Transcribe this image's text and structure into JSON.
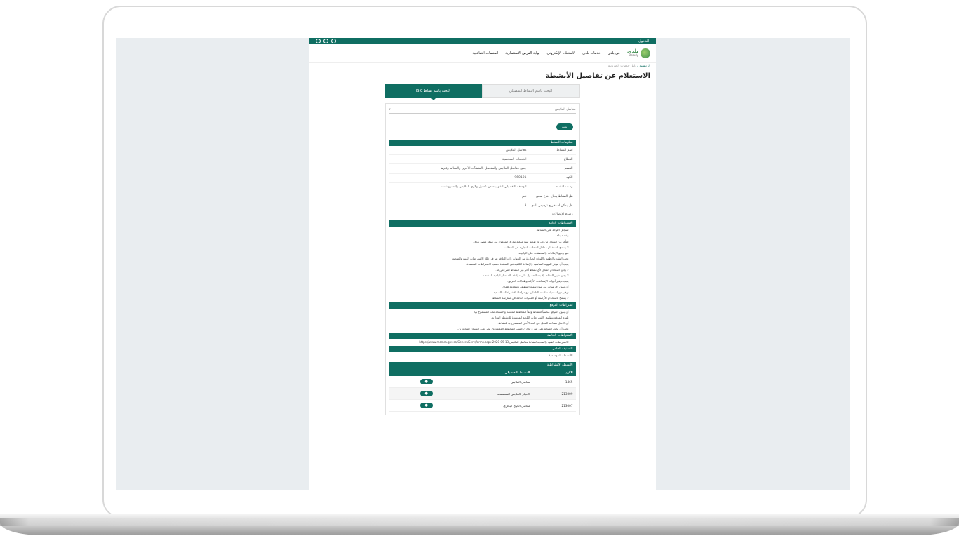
{
  "topbar": {
    "login": "الدخول"
  },
  "nav": {
    "logo_ar": "بلدي",
    "logo_en": "Balady",
    "links": [
      "عن بلدي",
      "خدمات بلدي",
      "الاستعلام الإلكتروني",
      "بوابة الفرص الاستثمارية",
      "المنصات التفاعلية"
    ]
  },
  "breadcrumb": {
    "home": "الرئيسية",
    "current": "دليل خدمات إلكترونية"
  },
  "page_title": "الاستعلام عن تفاصيل الأنشطة",
  "tabs": {
    "active": "البحث باسم نشاط ISIC",
    "inactive": "البحث باسم النشاط التفصيلي"
  },
  "select": {
    "value": "مغاسل الملابس"
  },
  "search_button": "بحث",
  "sections": {
    "info": "معلومات النشاط",
    "conditions": "الاشتراطات العامة",
    "location": "اشتراطات الموقع",
    "special": "الاشتراطات الخاصة",
    "classification": "التصنيف الخاص",
    "related": "الأنشطة الاشتراطية"
  },
  "info_rows": [
    {
      "k": "اسم النشاط",
      "v": "مغاسل الملابس"
    },
    {
      "k": "القطاع",
      "v": "الخدمات الشخصية"
    },
    {
      "k": "القسم",
      "v": "جميع مغاسل الملابس والمغاسل بالمنشآت الأخرى والمعالم وغيرها"
    },
    {
      "k": "الكود",
      "v": "960101"
    },
    {
      "k": "وصف النشاط",
      "v": "الوصف التفصيلي الذي يتضمن غسيل وكوي الملابس والمفروشات"
    },
    {
      "k": "هل النشاط يحتاج دفاع مدني",
      "v": "نعم"
    },
    {
      "k": "هل يمكن استخراج ترخيص بلدي",
      "v": "لا"
    }
  ],
  "category_note": "رسوم الإيصالات",
  "conditions": [
    "تسجيل اللوحة على النشاط.",
    "رخصة بناء.",
    "التأكد من السجل من طريق تقديم سند ملكية ساري المفعول من موقع منصة بلدي.",
    "لا يسمح باستخدام مداخل المحلات التجارية في المحلات.",
    "منع وضع الإعلانات والملصقات على الواجهة.",
    "يجب التقيد بالأنظمة واللوائح الصادرة من الجهات ذات العلاقة بما في ذلك الاشتراطات الفنية والصحية.",
    "يجب أن تتوفر التهوية المناسبة والإضاءة الكافية في المنشأة حسب الاشتراطات المعتمدة.",
    "لا يجوز استخدام المحل لأي نشاط آخر غير النشاط المرخص له.",
    "لا يجوز تغيير النشاط إلا بعد الحصول على موافقة الأمانة أو البلدية المختصة.",
    "يجب توفير أدوات الإسعافات الأولية وطفايات الحريق.",
    "أن تكون الأرضيات من مواد سهلة التنظيف ومقاومة للماء.",
    "توفير دورات مياه مناسبة للعاملين مع مراعاة الاشتراطات الصحية.",
    "لا يسمح باستخدام الأرصفة أو الممرات العامة في ممارسة النشاط."
  ],
  "location": [
    "أن يكون الموقع مناسباً للنشاط وفقاً للمخطط المعتمد والاستخدامات المسموح بها.",
    "يلتزم الموقع بتطبيق الاشتراطات البلدية المعتمدة للأنشطة التجارية.",
    "أن لا تقل مساحة المحل عن الحد الأدنى المسموح به للنشاط.",
    "يجب أن يكون الموقع على شارع تجاري حسب المخطط المعتمد ولا يؤثر على السكان المجاورين."
  ],
  "special": [
    "الاشتراطات الفنية والصحية لنشاط مغاسل الملابس https://www.momra.gov.sa/GeneralServ/forms.aspx 2020-09-13"
  ],
  "classification": "الأنشطة الموسمية",
  "related": {
    "headers": [
      "الكود",
      "النشاط التفصيلي"
    ],
    "rows": [
      [
        "1465",
        "مغاسل الملابس"
      ],
      [
        "213009",
        "الاتجار بالملابس المستعملة"
      ],
      [
        "213007",
        "مغاسل الكوي البخاري"
      ]
    ]
  }
}
